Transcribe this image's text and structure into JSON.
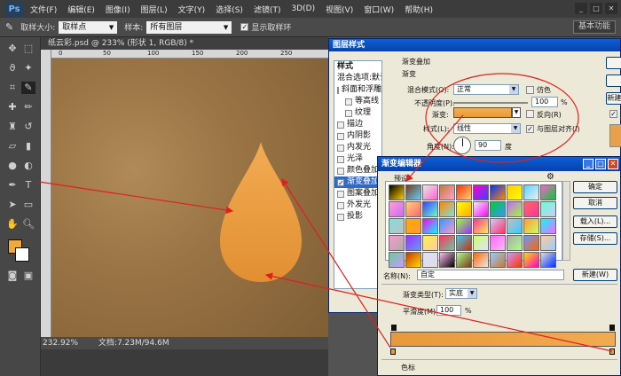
{
  "app": {
    "logo": "Ps"
  },
  "menubar": {
    "items": [
      "文件(F)",
      "编辑(E)",
      "图像(I)",
      "图层(L)",
      "文字(Y)",
      "选择(S)",
      "滤镜(T)",
      "3D(D)",
      "视图(V)",
      "窗口(W)",
      "帮助(H)"
    ]
  },
  "optbar": {
    "sample_size_label": "取样大小:",
    "sample_size_value": "取样点",
    "sample_label": "样本:",
    "sample_value": "所有图层",
    "show_ring_label": "显示取样环",
    "basic_func": "基本功能"
  },
  "doc": {
    "tab": "纸云彩.psd @ 233% (形状 1, RGB/8) *",
    "zoom": "232.92%",
    "doc_info": "文档:7.23M/94.6M",
    "ruler_nums": [
      "0",
      "50",
      "100",
      "150",
      "200",
      "250",
      "300"
    ],
    "ruler_left": [
      "0",
      "50",
      "100",
      "150",
      "200"
    ]
  },
  "colors": {
    "foreground": "#f2a93a",
    "background": "#ffffff",
    "droplet": "#e8983a"
  },
  "layer_style": {
    "title": "图层样式",
    "styles_header": "样式",
    "blend_default": "混合选项:默认",
    "items": [
      "斜面和浮雕",
      "等高线",
      "纹理",
      "描边",
      "内阴影",
      "内发光",
      "光泽",
      "颜色叠加",
      "渐变叠加",
      "图案叠加",
      "外发光",
      "投影"
    ],
    "group_title": "渐变叠加",
    "sub_title": "渐变",
    "blend_mode_label": "混合模式(O):",
    "blend_mode_value": "正常",
    "dither_label": "仿色",
    "opacity_label": "不透明度(P):",
    "opacity_value": "100",
    "opacity_unit": "%",
    "gradient_label": "渐变:",
    "reverse_label": "反向(R)",
    "style_label": "样式(L):",
    "style_value": "线性",
    "align_label": "与图层对齐(I)",
    "angle_label": "角度(N):",
    "angle_value": "90",
    "angle_unit": "度",
    "new_style_btn": "新建("
  },
  "gradient_editor": {
    "title": "渐变编辑器",
    "presets_label": "预设",
    "ok": "确定",
    "cancel": "取消",
    "load": "载入(L)...",
    "save": "存储(S)...",
    "name_label": "名称(N):",
    "name_value": "自定",
    "new_btn": "新建(W)",
    "type_label": "渐变类型(T):",
    "type_value": "实底",
    "smooth_label": "平滑度(M):",
    "smooth_value": "100",
    "smooth_unit": "%",
    "stops_label": "色标",
    "swatches": [
      "#000000",
      "#7a3b1a",
      "#e8e8e8",
      "#c47a3a",
      "#ff3300",
      "#ff00cc",
      "#0033ff",
      "#ffcc00",
      "#5ad2ff",
      "#ff5fcf",
      "#ffa0d0",
      "#ffd080",
      "#4040ff",
      "#ff8800",
      "#ffff00",
      "#eeeeee",
      "#00cc33",
      "#cc66ff",
      "#ff6666",
      "#66ffcc",
      "#7fe0e0",
      "#ffaa00",
      "#ff00ff",
      "#3399ff",
      "#99ff33",
      "#ff3399",
      "#ccccff",
      "#c0c0c0",
      "#ff9933",
      "#00ffff",
      "#ff99cc",
      "#9933ff",
      "#ffee55",
      "#ff3366",
      "#33ccff",
      "#ccff66",
      "#ff66ff",
      "#aaaaaa",
      "#6699ff",
      "#ffcc99",
      "#66cc99",
      "#cc3300",
      "#e0e0ff",
      "#ffbbee",
      "#aaff88",
      "#ff6600",
      "#99ccff",
      "#cc99ff",
      "#ffdd00",
      "#dddddd"
    ]
  }
}
